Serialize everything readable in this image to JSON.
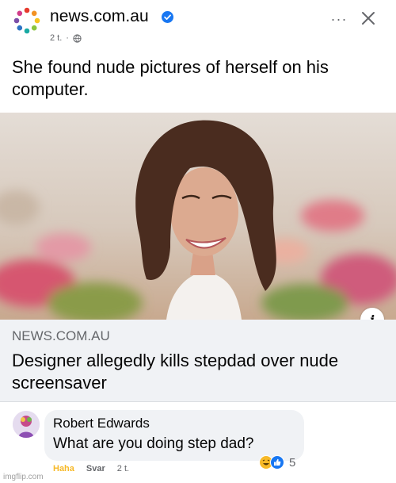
{
  "header": {
    "page_name": "news.com.au",
    "timestamp": "2 t.",
    "more_label": "···"
  },
  "post": {
    "text": "She found nude pictures of herself on his computer."
  },
  "link_preview": {
    "domain": "NEWS.COM.AU",
    "title": "Designer allegedly kills stepdad over nude screensaver",
    "info_label": "i"
  },
  "comment": {
    "author": "Robert Edwards",
    "text": "What are you doing step dad?",
    "reaction_count": "5",
    "actions": {
      "haha": "Haha",
      "reply": "Svar",
      "time": "2 t."
    }
  },
  "watermark": "imgflip.com",
  "icons": {
    "verified": "verified-badge-icon",
    "globe": "globe-icon",
    "close": "close-icon",
    "info": "info-icon",
    "reactions": [
      "haha-reaction-icon",
      "like-reaction-icon"
    ]
  },
  "colors": {
    "accent": "#1877f2",
    "haha": "#f7b928",
    "secondary_text": "#65676b",
    "preview_bg": "#f0f2f5"
  }
}
